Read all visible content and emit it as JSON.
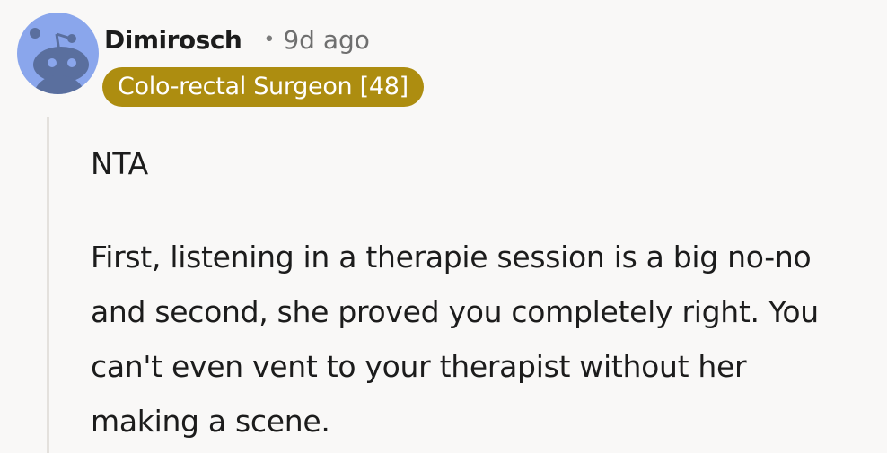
{
  "comment": {
    "username": "Dimirosch",
    "separator": "•",
    "timestamp": "9d ago",
    "flair": "Colo-rectal Surgeon [48]",
    "avatar_icon": "snoo-avatar-icon",
    "paragraphs": [
      "NTA",
      "First, listening in a therapie session is a big no-no and second, she proved you completely right. You can't even vent to your therapist without her making a scene."
    ]
  },
  "colors": {
    "background": "#f9f8f7",
    "avatar_bg": "#8aa6ec",
    "flair_bg": "#ad8d10",
    "flair_text": "#ffffff",
    "text": "#1c1c1c",
    "muted": "#6f6f6f"
  }
}
